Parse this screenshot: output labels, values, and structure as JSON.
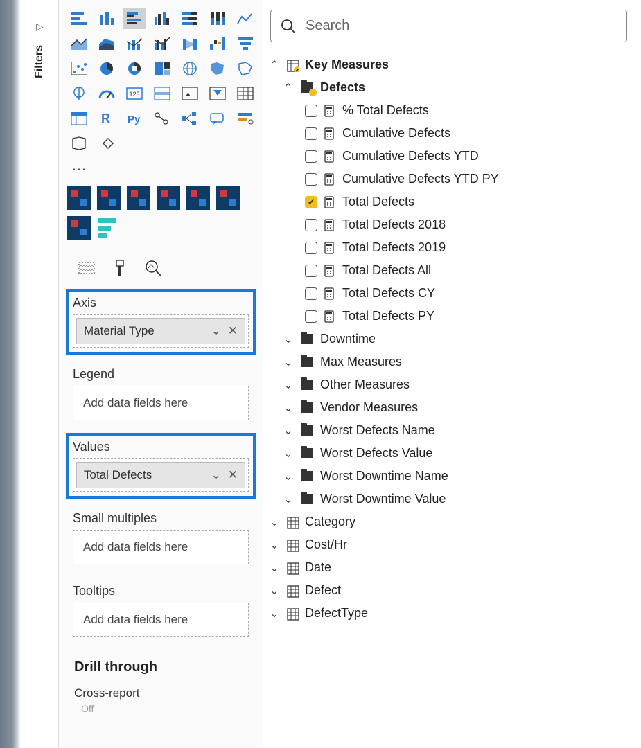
{
  "filters_pane": {
    "label": "Filters"
  },
  "search": {
    "placeholder": "Search"
  },
  "wells": {
    "axis": {
      "label": "Axis",
      "value": "Material Type"
    },
    "legend": {
      "label": "Legend",
      "placeholder": "Add data fields here"
    },
    "values": {
      "label": "Values",
      "value": "Total Defects"
    },
    "small_multiples": {
      "label": "Small multiples",
      "placeholder": "Add data fields here"
    },
    "tooltips": {
      "label": "Tooltips",
      "placeholder": "Add data fields here"
    }
  },
  "drill_through": {
    "header": "Drill through",
    "cross_report": "Cross-report",
    "state": "Off"
  },
  "tree": {
    "key_measures": "Key Measures",
    "defects": {
      "label": "Defects",
      "items": [
        {
          "label": "% Total Defects",
          "checked": false
        },
        {
          "label": "Cumulative Defects",
          "checked": false
        },
        {
          "label": "Cumulative Defects YTD",
          "checked": false
        },
        {
          "label": "Cumulative Defects YTD PY",
          "checked": false
        },
        {
          "label": "Total Defects",
          "checked": true
        },
        {
          "label": "Total Defects 2018",
          "checked": false
        },
        {
          "label": "Total Defects 2019",
          "checked": false
        },
        {
          "label": "Total Defects All",
          "checked": false
        },
        {
          "label": "Total Defects CY",
          "checked": false
        },
        {
          "label": "Total Defects PY",
          "checked": false
        }
      ]
    },
    "folders": [
      "Downtime",
      "Max Measures",
      "Other Measures",
      "Vendor Measures",
      "Worst Defects Name",
      "Worst Defects Value",
      "Worst Downtime Name",
      "Worst Downtime Value"
    ],
    "tables": [
      "Category",
      "Cost/Hr",
      "Date",
      "Defect",
      "DefectType"
    ]
  }
}
